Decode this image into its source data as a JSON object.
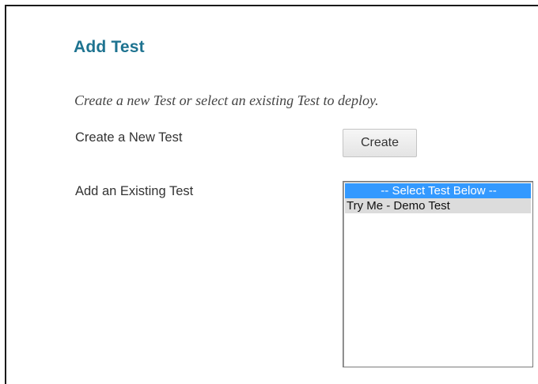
{
  "page": {
    "title": "Add Test",
    "instructions": "Create a new Test or select an existing Test to deploy."
  },
  "create_row": {
    "label": "Create a New Test",
    "button_label": "Create"
  },
  "existing_row": {
    "label": "Add an Existing Test",
    "options": [
      {
        "label": "-- Select Test Below --",
        "selected": true
      },
      {
        "label": "Try Me - Demo Test",
        "selected": false
      }
    ]
  },
  "colors": {
    "title": "#1e7390",
    "selection": "#3399ff",
    "option_hover": "#dcdcdc"
  }
}
